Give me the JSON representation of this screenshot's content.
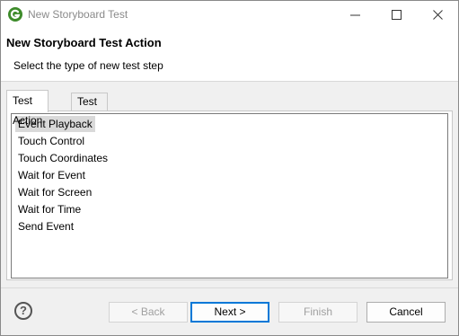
{
  "window": {
    "title": "New Storyboard Test"
  },
  "header": {
    "title": "New Storyboard Test Action",
    "subtitle": "Select the type of new test step"
  },
  "tabs": [
    {
      "label": "Test Action",
      "active": true
    },
    {
      "label": "Test Point",
      "active": false
    }
  ],
  "list": {
    "items": [
      "Event Playback",
      "Touch Control",
      "Touch Coordinates",
      "Wait for Event",
      "Wait for Screen",
      "Wait for Time",
      "Send Event"
    ],
    "selected": "Event Playback"
  },
  "buttons": {
    "help": "?",
    "back": "< Back",
    "next": "Next >",
    "finish": "Finish",
    "cancel": "Cancel"
  },
  "icons": {
    "app": "app-logo-icon",
    "minimize": "minimize-icon",
    "maximize": "maximize-icon",
    "close": "close-icon",
    "help": "help-icon"
  }
}
